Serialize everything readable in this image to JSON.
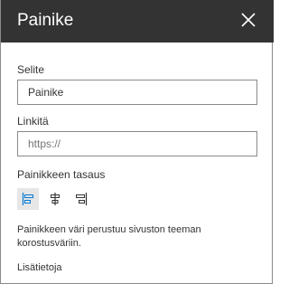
{
  "panel": {
    "title": "Painike",
    "close_icon": "close-icon"
  },
  "label_field": {
    "label": "Selite",
    "value": "Painike"
  },
  "link_field": {
    "label": "Linkitä",
    "placeholder": "https://"
  },
  "alignment": {
    "label": "Painikkeen tasaus",
    "options": [
      {
        "name": "align-left-icon",
        "selected": true
      },
      {
        "name": "align-center-icon",
        "selected": false
      },
      {
        "name": "align-right-icon",
        "selected": false
      }
    ]
  },
  "note": "Painikkeen väri perustuu sivuston teeman korostusväriin.",
  "more_link": "Lisätietoja"
}
